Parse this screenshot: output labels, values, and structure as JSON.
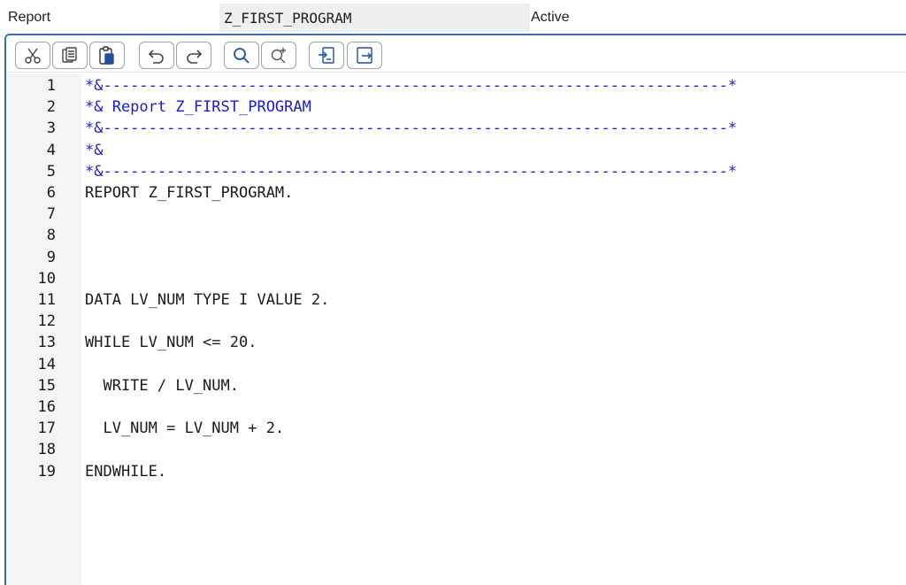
{
  "header": {
    "type_label": "Report",
    "program_name": "Z_FIRST_PROGRAM",
    "status": "Active"
  },
  "toolbar": {
    "buttons": [
      {
        "icon": "cut-icon"
      },
      {
        "icon": "copy-icon"
      },
      {
        "icon": "paste-icon"
      },
      {
        "icon": "undo-icon"
      },
      {
        "icon": "redo-icon"
      },
      {
        "icon": "search-icon"
      },
      {
        "icon": "search-next-icon"
      },
      {
        "icon": "insert-block-icon"
      },
      {
        "icon": "extract-block-icon"
      }
    ]
  },
  "colors": {
    "comment": "#1a1ad6",
    "code": "#1a1a1a",
    "frame_border": "#3a6ea8",
    "gutter_bg": "#f3f4f6"
  },
  "code": {
    "lines": [
      {
        "number": "1",
        "text": "*&---------------------------------------------------------------------*",
        "kind": "comment"
      },
      {
        "number": "2",
        "text": "*& Report Z_FIRST_PROGRAM",
        "kind": "comment"
      },
      {
        "number": "3",
        "text": "*&---------------------------------------------------------------------*",
        "kind": "comment"
      },
      {
        "number": "4",
        "text": "*&",
        "kind": "comment"
      },
      {
        "number": "5",
        "text": "*&---------------------------------------------------------------------*",
        "kind": "comment"
      },
      {
        "number": "6",
        "text": "REPORT Z_FIRST_PROGRAM.",
        "kind": "code"
      },
      {
        "number": "7",
        "text": "",
        "kind": "code"
      },
      {
        "number": "8",
        "text": "",
        "kind": "code"
      },
      {
        "number": "9",
        "text": "",
        "kind": "code"
      },
      {
        "number": "10",
        "text": "",
        "kind": "code"
      },
      {
        "number": "11",
        "text": "DATA LV_NUM TYPE I VALUE 2.",
        "kind": "code"
      },
      {
        "number": "12",
        "text": "",
        "kind": "code"
      },
      {
        "number": "13",
        "text": "WHILE LV_NUM <= 20.",
        "kind": "code"
      },
      {
        "number": "14",
        "text": "",
        "kind": "code"
      },
      {
        "number": "15",
        "text": "  WRITE / LV_NUM.",
        "kind": "code"
      },
      {
        "number": "16",
        "text": "",
        "kind": "code"
      },
      {
        "number": "17",
        "text": "  LV_NUM = LV_NUM + 2.",
        "kind": "code"
      },
      {
        "number": "18",
        "text": "",
        "kind": "code"
      },
      {
        "number": "19",
        "text": "ENDWHILE.",
        "kind": "code"
      }
    ]
  }
}
